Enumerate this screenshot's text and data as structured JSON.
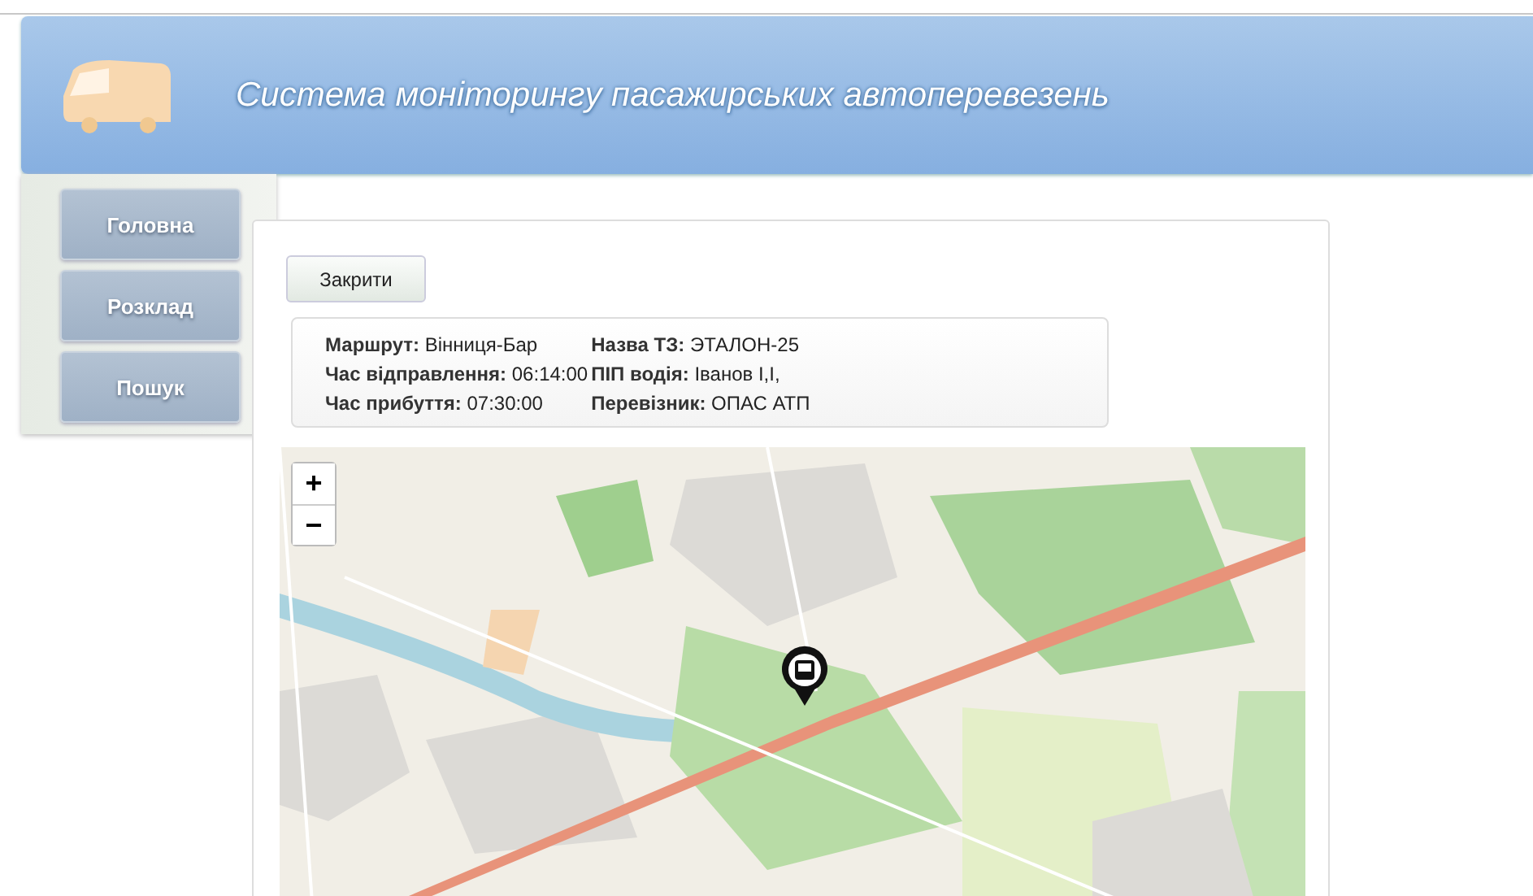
{
  "header": {
    "title": "Система моніторингу пасажирських автоперевезень"
  },
  "nav": [
    {
      "label": "Головна"
    },
    {
      "label": "Розклад"
    },
    {
      "label": "Пошук"
    }
  ],
  "close_button": "Закрити",
  "info_columns": [
    [
      "**Маршрут:** Вінниця-Бар",
      "**Час відправлення:** 06:14:00",
      "**Час прибуття:** 07:30:00"
    ],
    [
      "**Назва ТЗ:** ЭТАЛОН-25",
      "**ПІП водія:** Іванов І,І,",
      "**Перевізник:** ОПАС АТП"
    ]
  ],
  "map": {
    "kind": "picture",
    "zoom_in": "+",
    "zoom_out": "−"
  }
}
